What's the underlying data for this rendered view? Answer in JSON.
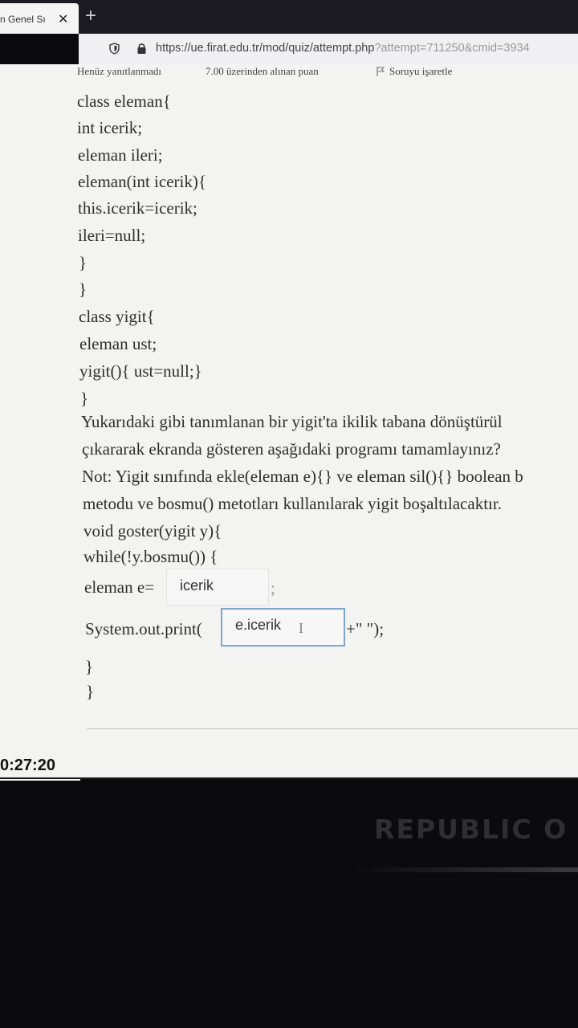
{
  "browser": {
    "tab_title": "n Genel Sı",
    "close_glyph": "✕",
    "new_tab_glyph": "+",
    "url_main": "https://ue.firat.edu.tr/mod/quiz/attempt.php",
    "url_query": "?attempt=711250&cmid=3934"
  },
  "question_info": {
    "status": "Henüz yanıtlanmadı",
    "points": "7.00 üzerinden alınan puan",
    "flag_label": "Soruyu işaretle"
  },
  "code_lines": {
    "l1": "class eleman{",
    "l2": "int icerik;",
    "l3": "eleman ileri;",
    "l4": "eleman(int icerik){",
    "l5": "this.icerik=icerik;",
    "l6": "ileri=null;",
    "l7": "}",
    "l8": "}",
    "l9": "class yigit{",
    "l10": "eleman ust;",
    "l11": "yigit(){ ust=null;}",
    "l12": "}"
  },
  "question_text": {
    "q1": "Yukarıdaki gibi tanımlanan bir yigit'ta ikilik tabana dönüştürül",
    "q2": "çıkararak ekranda gösteren aşağıdaki programı tamamlayınız?",
    "q3": "Not: Yigit sınıfında ekle(eleman e){} ve eleman sil(){} boolean b",
    "q4": "metodu ve bosmu() metotları kullanılarak yigit boşaltılacaktır."
  },
  "program": {
    "p1": "void goster(yigit y){",
    "p2": "while(!y.bosmu()) {",
    "p3_prefix": "eleman e=",
    "p3_suffix": ";",
    "p4_prefix": "System.out.print(",
    "p4_suffix": "+\" \");",
    "p5": "}",
    "p6": "}"
  },
  "answers": {
    "blank1": "icerik",
    "blank2": "e.icerik"
  },
  "timer": "0:27:20",
  "device": {
    "brand_text": "REPUBLIC O"
  },
  "colors": {
    "page_bg": "#f3f3f1",
    "focus_border": "#7fa5cf"
  },
  "icons": [
    "shield-icon",
    "lock-icon",
    "flag-icon",
    "close-icon",
    "plus-icon",
    "text-cursor-icon"
  ]
}
